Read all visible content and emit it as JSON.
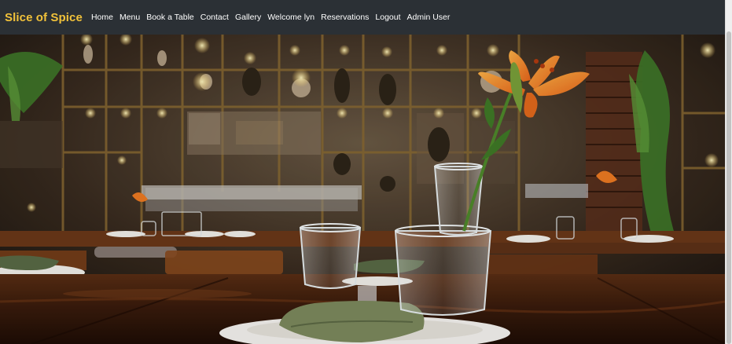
{
  "navbar": {
    "brand": "Slice of Spice",
    "links": [
      {
        "label": "Home"
      },
      {
        "label": "Menu"
      },
      {
        "label": "Book a Table"
      },
      {
        "label": "Contact"
      },
      {
        "label": "Gallery"
      },
      {
        "label": "Welcome lyn"
      },
      {
        "label": "Reservations"
      },
      {
        "label": "Logout"
      },
      {
        "label": "Admin User"
      }
    ]
  },
  "colors": {
    "navbar_bg": "#2b3035",
    "brand": "#f2c23a",
    "link": "#ffffff"
  }
}
